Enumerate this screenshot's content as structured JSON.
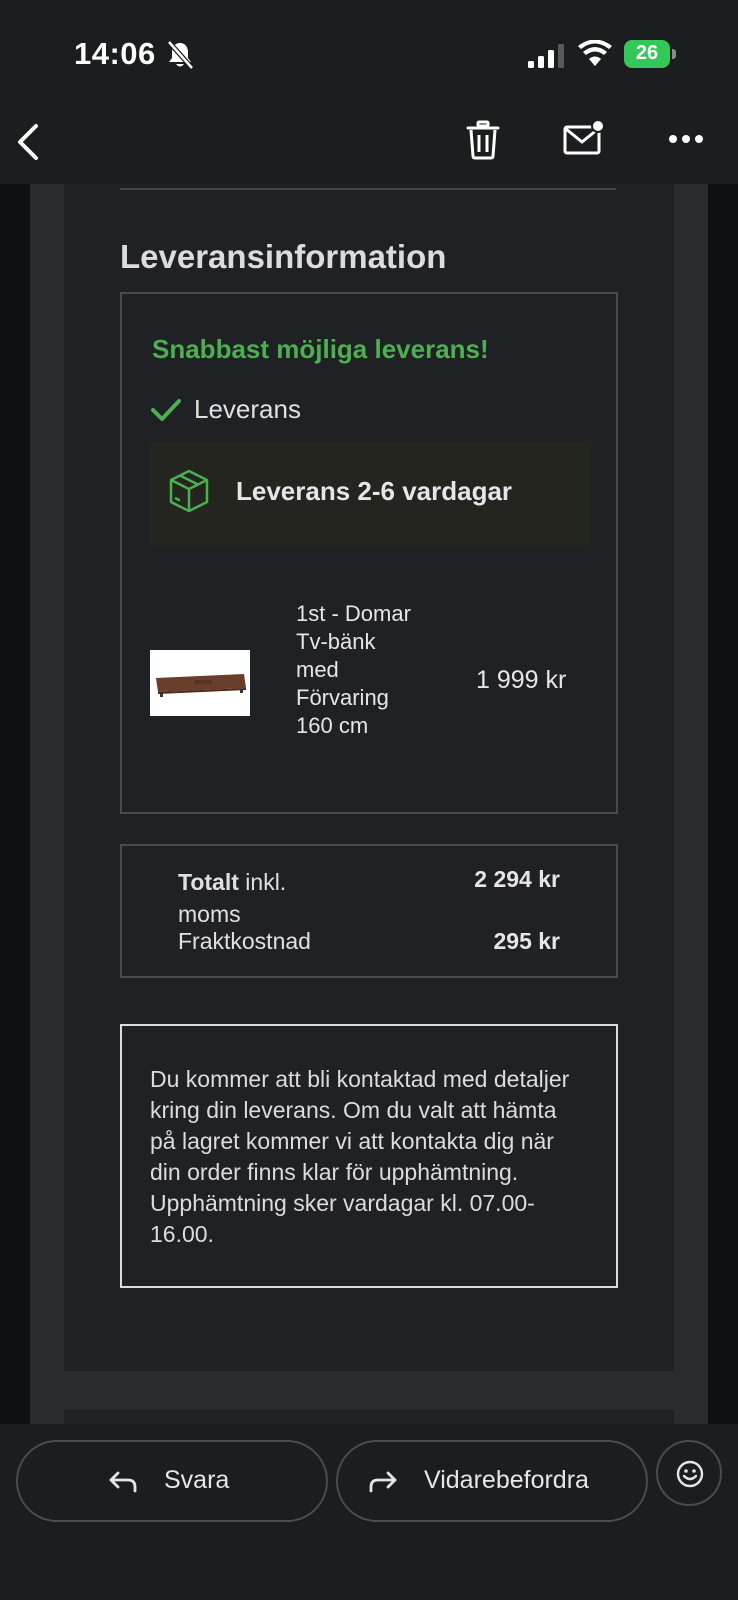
{
  "status_bar": {
    "time": "14:06",
    "battery_level": "26"
  },
  "nav": {
    "back_icon": "chevron-left-icon",
    "trash_icon": "trash-icon",
    "mail_icon": "mark-unread-icon",
    "more_icon": "more-icon"
  },
  "email": {
    "section_title": "Leveransinformation",
    "delivery": {
      "headline": "Snabbast möjliga leverans!",
      "option_label": "Leverans",
      "time_label": "Leverans 2-6 vardagar",
      "accent_color": "#4caf50"
    },
    "product": {
      "name": "1st - Domar Tv-bänk med Förvaring 160 cm",
      "price": "1 999 kr"
    },
    "totals": {
      "total_label_bold": "Totalt",
      "total_label_rest": " inkl. moms",
      "total_value": "2 294 kr",
      "shipping_label": "Fraktkostnad",
      "shipping_value": "295 kr"
    },
    "info_text": "Du kommer att bli kontaktad med detaljer kring din leverans. Om du valt att hämta på lagret kommer vi att kontakta dig när din order finns klar för upphämtning. Upphämtning sker vardagar kl. 07.00-16.00."
  },
  "bottom_bar": {
    "reply_label": "Svara",
    "forward_label": "Vidarebefordra"
  }
}
